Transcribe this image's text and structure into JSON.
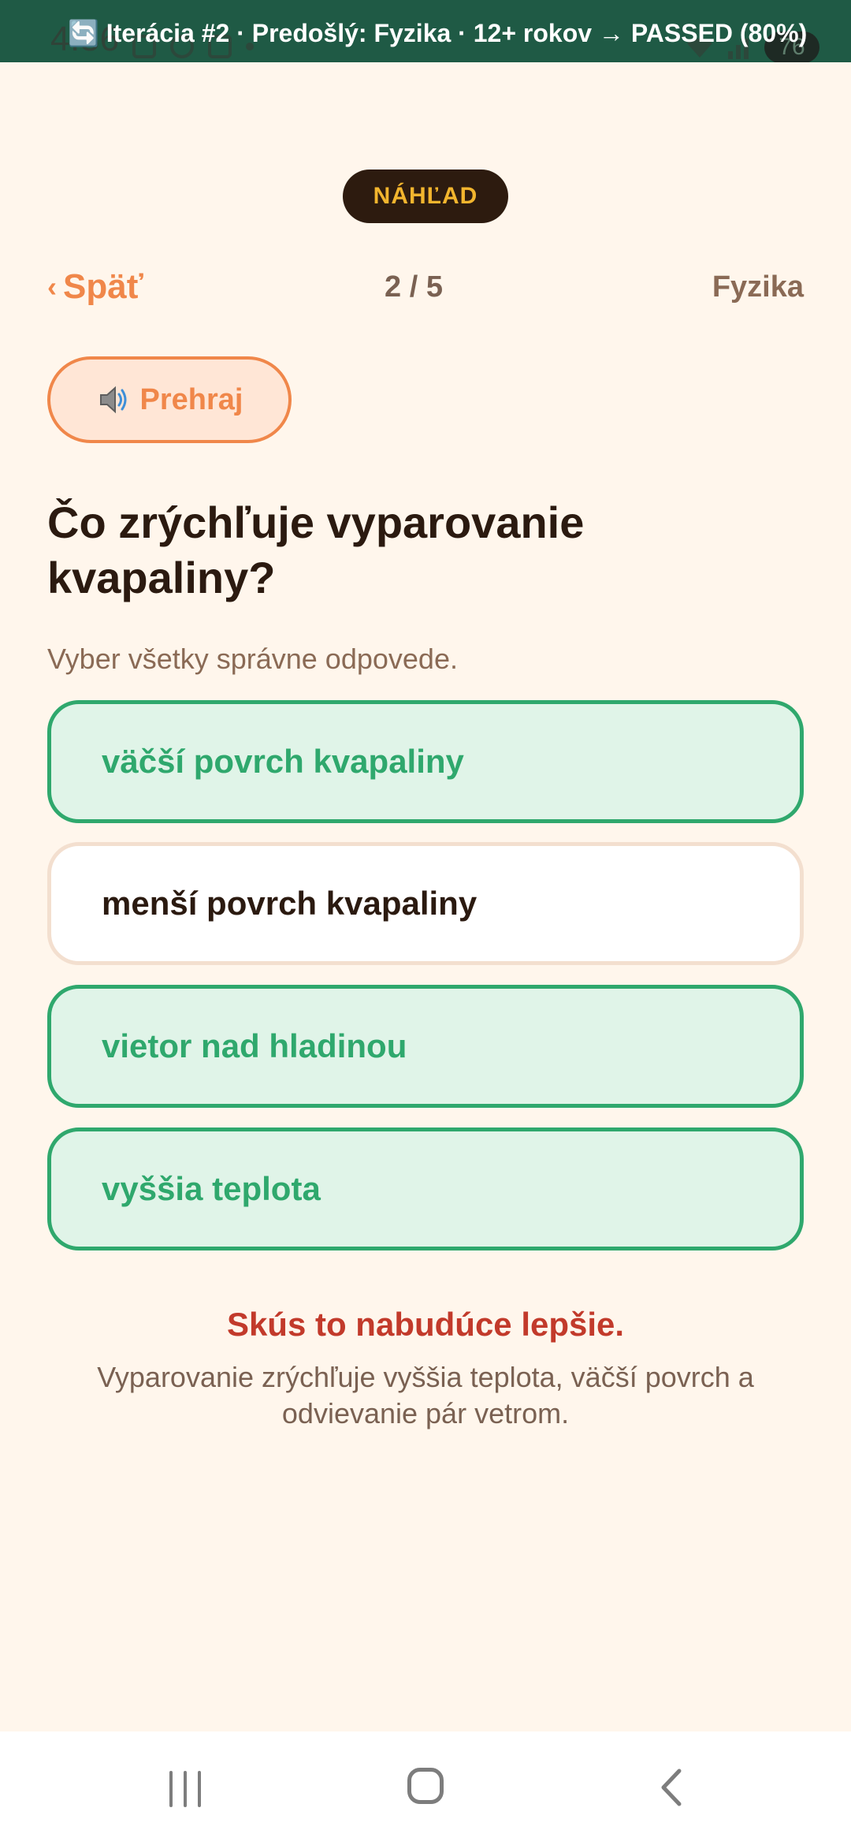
{
  "status_bar": {
    "time": "4:36",
    "battery": "76"
  },
  "banner": {
    "icon": "refresh-icon",
    "text": "🔄 Iterácia #2 · Predošlý: Fyzika · 12+ rokov → PASSED (80%)"
  },
  "preview_badge": "NÁHĽAD",
  "nav": {
    "back_label": "Späť",
    "back_chevron": "‹",
    "progress": "2 / 5",
    "subject": "Fyzika"
  },
  "play_button": {
    "icon": "speaker-icon",
    "label": "Prehraj"
  },
  "question": {
    "title": "Čo zrýchľuje vyparovanie kvapaliny?",
    "instruction": "Vyber všetky správne odpovede."
  },
  "options": [
    {
      "label": "väčší povrch kvapaliny",
      "state": "correct"
    },
    {
      "label": "menší povrch kvapaliny",
      "state": "neutral"
    },
    {
      "label": "vietor nad hladinou",
      "state": "correct"
    },
    {
      "label": "vyššia teplota",
      "state": "correct"
    }
  ],
  "feedback": {
    "title": "Skús to nabudúce lepšie.",
    "explanation": "Vyparovanie zrýchľuje vyššia teplota, väčší povrch a odvievanie pár vetrom."
  },
  "colors": {
    "background": "#FFF6EC",
    "accent": "#F0874A",
    "correct": "#2FA86D",
    "error": "#C23A2B",
    "banner": "#1F5A45"
  },
  "system_nav": {
    "recent_icon": "recent-apps-icon",
    "home_icon": "home-icon",
    "back_icon": "back-arrow-icon"
  }
}
